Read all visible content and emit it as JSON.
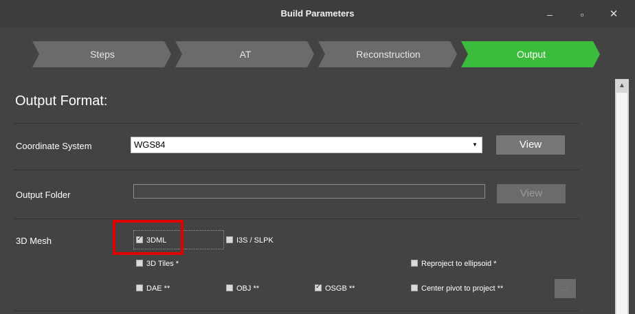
{
  "window": {
    "title": "Build Parameters",
    "minimize_icon": "minimize-icon",
    "maximize_icon": "maximize-icon",
    "close_icon": "close-icon"
  },
  "steps": [
    {
      "label": "Steps",
      "color": "#6b6b6b",
      "active": false
    },
    {
      "label": "AT",
      "color": "#6b6b6b",
      "active": false
    },
    {
      "label": "Reconstruction",
      "color": "#6b6b6b",
      "active": false
    },
    {
      "label": "Output",
      "color": "#3cbc3c",
      "active": true
    }
  ],
  "content": {
    "heading": "Output Format:",
    "coordinate_system": {
      "label": "Coordinate System",
      "value": "WGS84",
      "view_button": "View"
    },
    "output_folder": {
      "label": "Output Folder",
      "value": "",
      "view_button": "View"
    },
    "mesh": {
      "label": "3D Mesh",
      "options": [
        {
          "label": "3DML",
          "checked": true
        },
        {
          "label": "I3S / SLPK",
          "checked": false
        },
        {
          "label": "3D Tiles *",
          "checked": false
        },
        {
          "label": "Reproject to ellipsoid *",
          "checked": false
        },
        {
          "label": "DAE **",
          "checked": false
        },
        {
          "label": "OBJ **",
          "checked": false
        },
        {
          "label": "OSGB **",
          "checked": true
        },
        {
          "label": "Center pivot to project **",
          "checked": false
        }
      ],
      "more_button": "..."
    }
  },
  "colors": {
    "accent_active_step": "#3cbc3c",
    "highlight": "#e00000",
    "background": "#434343"
  }
}
